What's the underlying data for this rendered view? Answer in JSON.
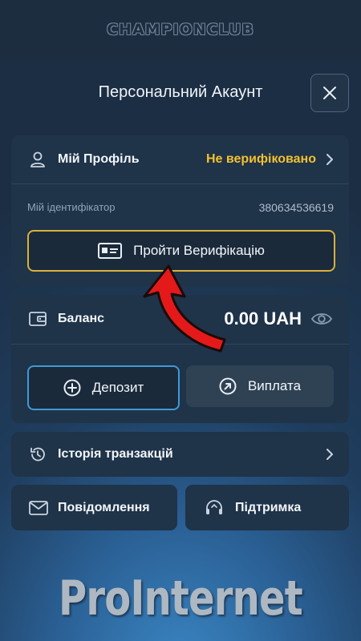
{
  "brand": {
    "logo_text": "CHAMPIONCLUB"
  },
  "header": {
    "title": "Персональний Акаунт"
  },
  "profile": {
    "label": "Мій Профіль",
    "status": "Не верифіковано",
    "id_label": "Мій ідентифікатор",
    "id_value": "380634536619",
    "verify_button": "Пройти Верифікацію"
  },
  "balance": {
    "label": "Баланс",
    "amount": "0.00 UAH",
    "deposit_button": "Депозит",
    "withdraw_button": "Виплата"
  },
  "history": {
    "label": "Історія транзакцій"
  },
  "messages": {
    "label": "Повідомлення"
  },
  "support": {
    "label": "Підтримка"
  },
  "watermark": {
    "text": "ProInternet"
  },
  "colors": {
    "warning": "#f2c12e",
    "accent_blue": "#3f9ad9",
    "arrow_red": "#e41a1a",
    "verify_border": "#d9b13c"
  }
}
